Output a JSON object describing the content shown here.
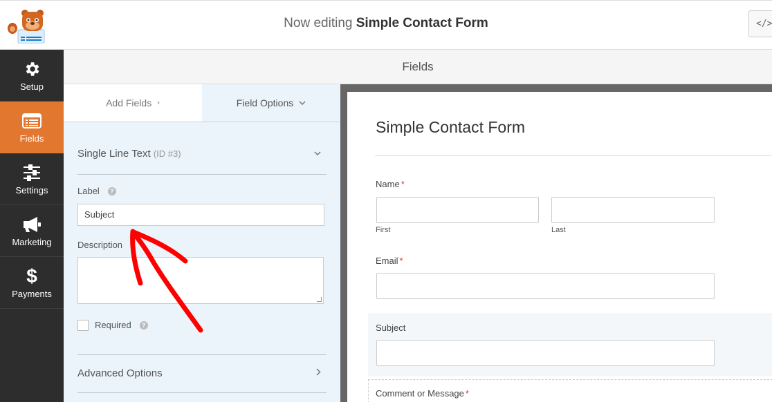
{
  "header": {
    "prefix": "Now editing",
    "form_name": "Simple Contact Form",
    "embed_button": "</>"
  },
  "sidebar": {
    "items": [
      {
        "label": "Setup",
        "icon": "gear-icon",
        "active": false
      },
      {
        "label": "Fields",
        "icon": "list-icon",
        "active": true
      },
      {
        "label": "Settings",
        "icon": "sliders-icon",
        "active": false
      },
      {
        "label": "Marketing",
        "icon": "megaphone-icon",
        "active": false
      },
      {
        "label": "Payments",
        "icon": "dollar-icon",
        "active": false
      }
    ]
  },
  "band": {
    "title": "Fields"
  },
  "panel": {
    "tabs": [
      {
        "label": "Add Fields",
        "chevron": "›"
      },
      {
        "label": "Field Options",
        "chevron": "⌄"
      }
    ],
    "field_type": "Single Line Text",
    "field_id": "(ID #3)",
    "label_caption": "Label",
    "label_value": "Subject",
    "description_caption": "Description",
    "description_value": "",
    "required_label": "Required",
    "required_checked": false,
    "advanced_options": "Advanced Options"
  },
  "preview": {
    "title": "Simple Contact Form",
    "fields": {
      "name_label": "Name",
      "first_sublabel": "First",
      "last_sublabel": "Last",
      "email_label": "Email",
      "subject_label": "Subject",
      "comment_label": "Comment or Message"
    },
    "required_mark": "*"
  },
  "colors": {
    "sidebar_bg": "#2d2d2d",
    "active_accent": "#e27730",
    "panel_bg": "#ebf3fb",
    "annotation_arrow": "#ff0000"
  }
}
